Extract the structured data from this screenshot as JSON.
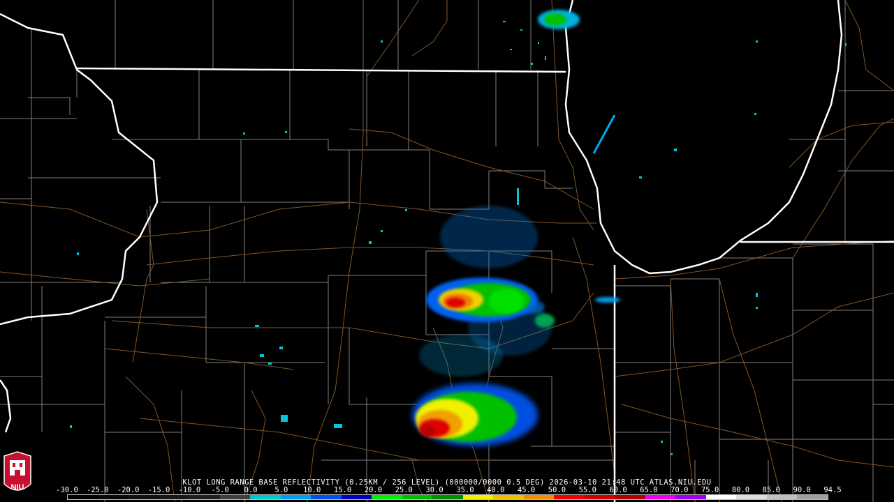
{
  "product": {
    "caption": "KLOT LONG RANGE BASE REFLECTIVITY (0.25KM / 256 LEVEL) (000000/0000 0.5 DEG) 2026-03-10 21:48 UTC  ATLAS.NIU.EDU"
  },
  "logo": {
    "text": "NIU"
  },
  "scale": {
    "labels": [
      "-30.0",
      "-25.0",
      "-20.0",
      "-15.0",
      "-10.0",
      "-5.0",
      "0.0",
      "5.0",
      "10.0",
      "15.0",
      "20.0",
      "25.0",
      "30.0",
      "35.0",
      "40.0",
      "45.0",
      "50.0",
      "55.0",
      "60.0",
      "65.0",
      "70.0",
      "75.0",
      "80.0",
      "85.0",
      "90.0",
      "94.5"
    ],
    "colors": [
      "#000000",
      "#0a0a0a",
      "#111111",
      "#181818",
      "#202020",
      "#404040",
      "#00c8c8",
      "#00a0f0",
      "#0050f0",
      "#0000c0",
      "#00f000",
      "#00c000",
      "#009000",
      "#f0f000",
      "#f0c000",
      "#f09000",
      "#f00000",
      "#d00000",
      "#b00000",
      "#f000f0",
      "#a000f0",
      "#ffffff",
      "#dddddd",
      "#c0c0c0",
      "#a0a0a0"
    ]
  },
  "map": {
    "colors": {
      "state_border": "#ffffff",
      "county_border": "#808080",
      "road": "#8b5a2b",
      "background": "#000000"
    }
  }
}
